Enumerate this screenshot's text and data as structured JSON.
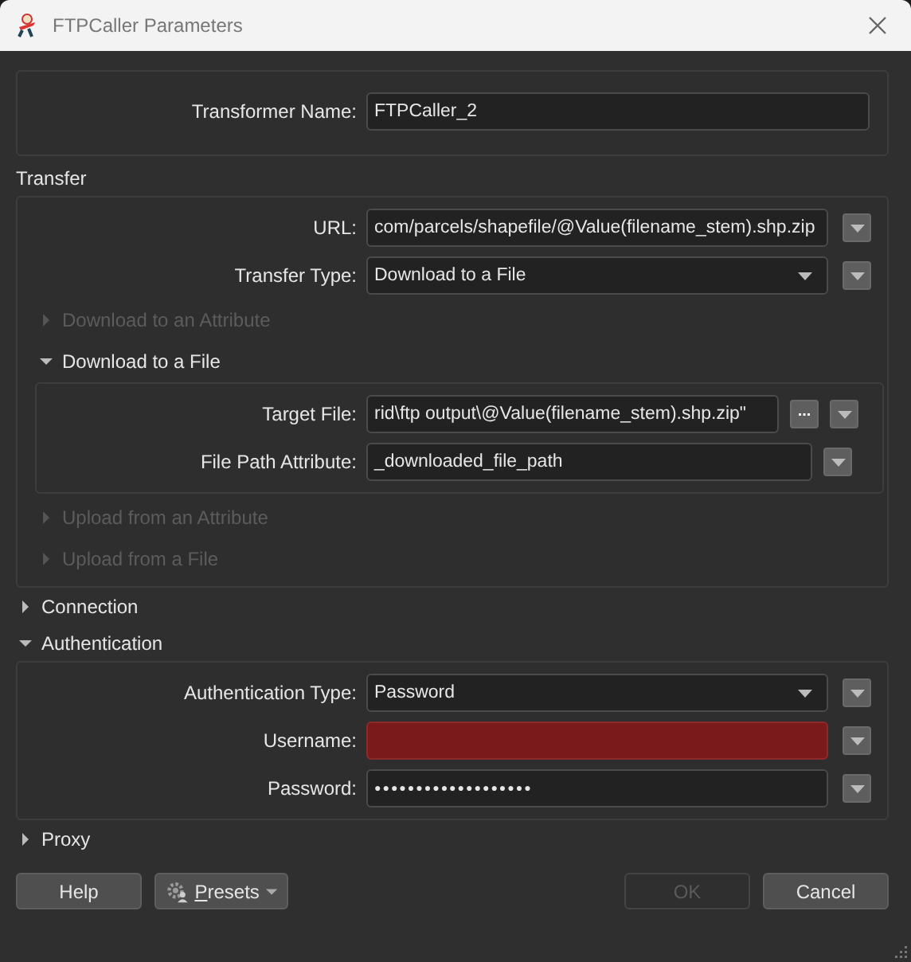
{
  "window": {
    "title": "FTPCaller Parameters"
  },
  "transformer_name": {
    "label": "Transformer Name:",
    "value": "FTPCaller_2"
  },
  "transfer": {
    "title": "Transfer",
    "fields": [
      {
        "label": "URL:",
        "value": "com/parcels/shapefile/@Value(filename_stem).shp.zip",
        "kind": "text",
        "invalid": false
      },
      {
        "label": "Transfer Type:",
        "value": "Download to a File",
        "kind": "dropdown",
        "invalid": false
      }
    ],
    "subsections": [
      {
        "title": "Download to an Attribute",
        "expanded": false,
        "disabled": true
      },
      {
        "title": "Download to a File",
        "expanded": true,
        "disabled": false,
        "fields": [
          {
            "label": "Target File:",
            "value": "rid\\ftp output\\@Value(filename_stem).shp.zip\"",
            "kind": "file",
            "browse": "...",
            "invalid": false
          },
          {
            "label": "File Path Attribute:",
            "value": "_downloaded_file_path",
            "kind": "attribute",
            "invalid": false
          }
        ]
      },
      {
        "title": "Upload from an Attribute",
        "expanded": false,
        "disabled": true
      },
      {
        "title": "Upload from a File",
        "expanded": false,
        "disabled": true
      }
    ]
  },
  "sections": [
    {
      "title": "Connection",
      "expanded": false
    },
    {
      "title": "Authentication",
      "expanded": true,
      "fields": [
        {
          "label": "Authentication Type:",
          "value": "Password",
          "kind": "dropdown",
          "invalid": false
        },
        {
          "label": "Username:",
          "kind": "text",
          "invalid": true
        },
        {
          "label": "Password:",
          "value": "●●●●●●●●●●●●●●●●●●●",
          "kind": "password",
          "invalid": false
        }
      ]
    },
    {
      "title": "Proxy",
      "expanded": false
    }
  ],
  "buttons": {
    "help": {
      "label": "Help",
      "disabled": false
    },
    "presets": {
      "label": "Presets",
      "disabled": false
    },
    "ok": {
      "label": "OK",
      "disabled": true
    },
    "cancel": {
      "label": "Cancel",
      "disabled": false
    }
  }
}
